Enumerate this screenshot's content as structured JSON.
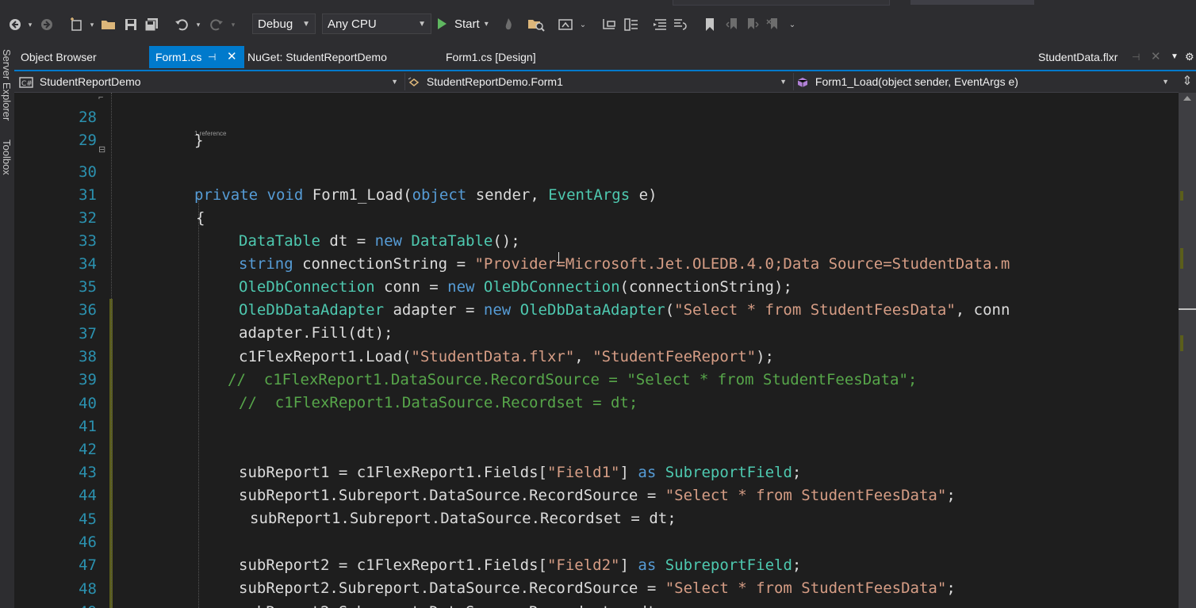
{
  "toolbar": {
    "config": "Debug",
    "platform": "Any CPU",
    "start_label": "Start"
  },
  "left_strip": {
    "server_explorer": "Server Explorer",
    "toolbox": "Toolbox"
  },
  "tabs": [
    {
      "label": "Object Browser"
    },
    {
      "label": "Form1.cs"
    },
    {
      "label": "NuGet: StudentReportDemo"
    },
    {
      "label": "Form1.cs [Design]"
    },
    {
      "label": "StudentData.flxr"
    }
  ],
  "navbar": {
    "project": "StudentReportDemo",
    "class": "StudentReportDemo.Form1",
    "member": "Form1_Load(object sender, EventArgs e)"
  },
  "editor": {
    "codelens": "1 reference",
    "lines": [
      {
        "n": "28",
        "text": "}"
      },
      {
        "n": "29",
        "text": ""
      },
      {
        "n": "30",
        "text": "private void Form1_Load(object sender, EventArgs e)"
      },
      {
        "n": "31",
        "text": "{"
      },
      {
        "n": "32",
        "text": "DataTable dt = new DataTable();"
      },
      {
        "n": "33",
        "text": "string connectionString = \"Provider=Microsoft.Jet.OLEDB.4.0;Data Source=StudentData.m"
      },
      {
        "n": "34",
        "text": "OleDbConnection conn = new OleDbConnection(connectionString);"
      },
      {
        "n": "35",
        "text": "OleDbDataAdapter adapter = new OleDbDataAdapter(\"Select * from StudentFeesData\", conn"
      },
      {
        "n": "36",
        "text": "adapter.Fill(dt);"
      },
      {
        "n": "37",
        "text": "c1FlexReport1.Load(\"StudentData.flxr\", \"StudentFeeReport\");"
      },
      {
        "n": "38",
        "text": "//  c1FlexReport1.DataSource.RecordSource = \"Select * from StudentFeesData\";"
      },
      {
        "n": "39",
        "text": "//  c1FlexReport1.DataSource.Recordset = dt;"
      },
      {
        "n": "40",
        "text": ""
      },
      {
        "n": "41",
        "text": ""
      },
      {
        "n": "42",
        "text": "subReport1 = c1FlexReport1.Fields[\"Field1\"] as SubreportField;"
      },
      {
        "n": "43",
        "text": "subReport1.Subreport.DataSource.RecordSource = \"Select * from StudentFeesData\";"
      },
      {
        "n": "44",
        "text": "subReport1.Subreport.DataSource.Recordset = dt;"
      },
      {
        "n": "45",
        "text": ""
      },
      {
        "n": "46",
        "text": "subReport2 = c1FlexReport1.Fields[\"Field2\"] as SubreportField;"
      },
      {
        "n": "47",
        "text": "subReport2.Subreport.DataSource.RecordSource = \"Select * from StudentFeesData\";"
      },
      {
        "n": "48",
        "text": "subReport2.Subreport.DataSource.Recordset = dt;"
      },
      {
        "n": "49",
        "text": ""
      }
    ]
  },
  "colors": {
    "keyword": "#569cd6",
    "type": "#4ec9b0",
    "string": "#d69d85",
    "comment": "#57a64a",
    "line_number": "#2b91af",
    "accent": "#007acc"
  }
}
